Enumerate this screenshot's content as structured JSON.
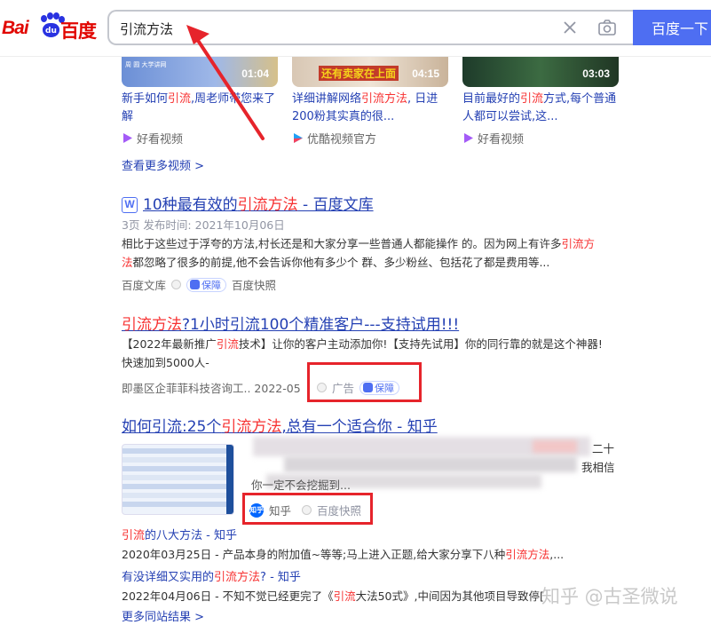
{
  "logo": {
    "bai": "Bai",
    "du": "du",
    "cn": "百度"
  },
  "search": {
    "value": "引流方法",
    "button_label": "百度一下"
  },
  "videos": [
    {
      "thumb_text": "周 圆 大学讲网",
      "duration": "01:04",
      "title_pre": "新手如何",
      "title_hl": "引流",
      "title_post": ",周老师带您来了解",
      "source": "好看视频"
    },
    {
      "thumb_text": "还有卖家在上面",
      "duration": "04:15",
      "title_pre": "详细讲解网络",
      "title_hl": "引流方法",
      "title_post": ", 日进200粉其实真的很...",
      "source": "优酷视频官方"
    },
    {
      "thumb_text": "",
      "duration": "03:03",
      "title_pre": "目前最好的",
      "title_hl": "引流",
      "title_post": "方式,每个普通人都可以尝试,这...",
      "source": "好看视频"
    }
  ],
  "more_videos": "查看更多视频 >",
  "result1": {
    "icon": "W",
    "title_pre": "10种最有效的",
    "title_hl": "引流方法",
    "title_post": " - 百度文库",
    "meta": "3页 发布时间: 2021年10月06日",
    "snippet_1_pre": "相比于这些过于浮夸的方法,村长还是和大家分享一些普通人都能操作 的。因为网上有许多",
    "snippet_1_hl": "引流方",
    "snippet_2_hl": "法",
    "snippet_2_post": "都忽略了很多的前提,他不会告诉你他有多少个 群、多少粉丝、包括花了都是费用等...",
    "source": "百度文库",
    "badge": "保障",
    "snapshot": "百度快照"
  },
  "result2": {
    "title_hl": "引流方法",
    "title_post": "?1小时引流100个精准客户---支持试用!!!",
    "snippet_1_pre": "【2022年最新推广",
    "snippet_1_hl": "引流",
    "snippet_1_post": "技术】让你的客户主动添加你!【支持先试用】你的同行靠的就是这个神器!",
    "snippet_2": "快速加到5000人-",
    "source": "即墨区企菲菲科技咨询工.. 2022-05",
    "ad": "广告",
    "badge": "保障"
  },
  "result3": {
    "title_pre": "如何引流:25个",
    "title_hl": "引流方法",
    "title_post": ",总有一个适合你 - 知乎",
    "snippet_frag_1": "二十",
    "snippet_frag_2": "我相信",
    "snippet_frag_3": "你一定不会挖掘到...",
    "source": "知乎",
    "snapshot": "百度快照",
    "sub_links": [
      {
        "pre": "",
        "hl": "引流",
        "post": "的八大方法 - 知乎",
        "kind": "link"
      },
      {
        "pre": "2020年03月25日 - 产品本身的附加值~等等;马上进入正题,给大家分享下八种",
        "hl": "引流方法",
        "post": ",...",
        "kind": "text"
      },
      {
        "pre": "有没详细又实用的",
        "hl": "引流方法",
        "post": "? - 知乎",
        "kind": "link"
      },
      {
        "pre": "2022年04月06日 - 不知不觉已经更完了《",
        "hl": "引流",
        "post": "大法50式》,中间因为其他项目导致停[",
        "kind": "text"
      }
    ],
    "more_results": "更多同站结果 >"
  },
  "watermark": "知乎 @古圣微说",
  "colors": {
    "link": "#2440b3",
    "highlight": "#f73131",
    "brand_blue": "#4e6ef2",
    "annotation_red": "#e6242b"
  }
}
